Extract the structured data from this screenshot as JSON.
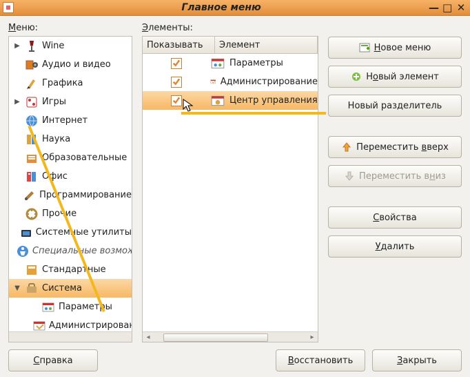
{
  "window": {
    "title": "Главное меню"
  },
  "labels": {
    "menu": "Меню:",
    "menu_ul": "М",
    "elements": "Элементы:",
    "elements_ul": "Э"
  },
  "tree": [
    {
      "exp": "closed",
      "icon": "wine",
      "label": "Wine"
    },
    {
      "exp": "none",
      "icon": "av",
      "label": "Аудио и видео"
    },
    {
      "exp": "none",
      "icon": "graphics",
      "label": "Графика"
    },
    {
      "exp": "closed",
      "icon": "games",
      "label": "Игры"
    },
    {
      "exp": "none",
      "icon": "internet",
      "label": "Интернет"
    },
    {
      "exp": "none",
      "icon": "science",
      "label": "Наука"
    },
    {
      "exp": "none",
      "icon": "edu",
      "label": "Образовательные"
    },
    {
      "exp": "none",
      "icon": "office",
      "label": "Офис"
    },
    {
      "exp": "none",
      "icon": "dev",
      "label": "Программирование"
    },
    {
      "exp": "none",
      "icon": "other",
      "label": "Прочие"
    },
    {
      "exp": "none",
      "icon": "sysutil",
      "label": "Системные утилиты"
    },
    {
      "exp": "none",
      "icon": "access",
      "label": "Специальные возможности",
      "italic": true
    },
    {
      "exp": "none",
      "icon": "standard",
      "label": "Стандартные"
    },
    {
      "exp": "open",
      "icon": "system",
      "label": "Система",
      "selected": true
    },
    {
      "exp": "none",
      "icon": "params",
      "label": "Параметры",
      "child": true
    },
    {
      "exp": "none",
      "icon": "admin",
      "label": "Администрирование",
      "child": true
    }
  ],
  "table": {
    "headers": {
      "show": "Показывать",
      "element": "Элемент"
    },
    "rows": [
      {
        "checked": true,
        "icon": "params",
        "label": "Параметры"
      },
      {
        "checked": true,
        "icon": "admin",
        "label": "Администрирование"
      },
      {
        "checked": true,
        "icon": "control",
        "label": "Центр управления",
        "selected": true
      }
    ]
  },
  "buttons": {
    "new_menu": {
      "label": "Новое меню",
      "ul": "Н"
    },
    "new_item": {
      "label": "Новый элемент",
      "ul": "о"
    },
    "new_sep": {
      "label": "Новый разделитель"
    },
    "move_up": {
      "label": "Переместить вверх",
      "ul": "в"
    },
    "move_down": {
      "label": "Переместить вниз",
      "ul": "н"
    },
    "props": {
      "label": "Свойства",
      "ul": "С"
    },
    "delete": {
      "label": "Удалить",
      "ul": "У"
    },
    "help": {
      "label": "Справка",
      "ul": "С"
    },
    "restore": {
      "label": "Восстановить",
      "ul": "В"
    },
    "close": {
      "label": "Закрыть",
      "ul": "З"
    }
  }
}
